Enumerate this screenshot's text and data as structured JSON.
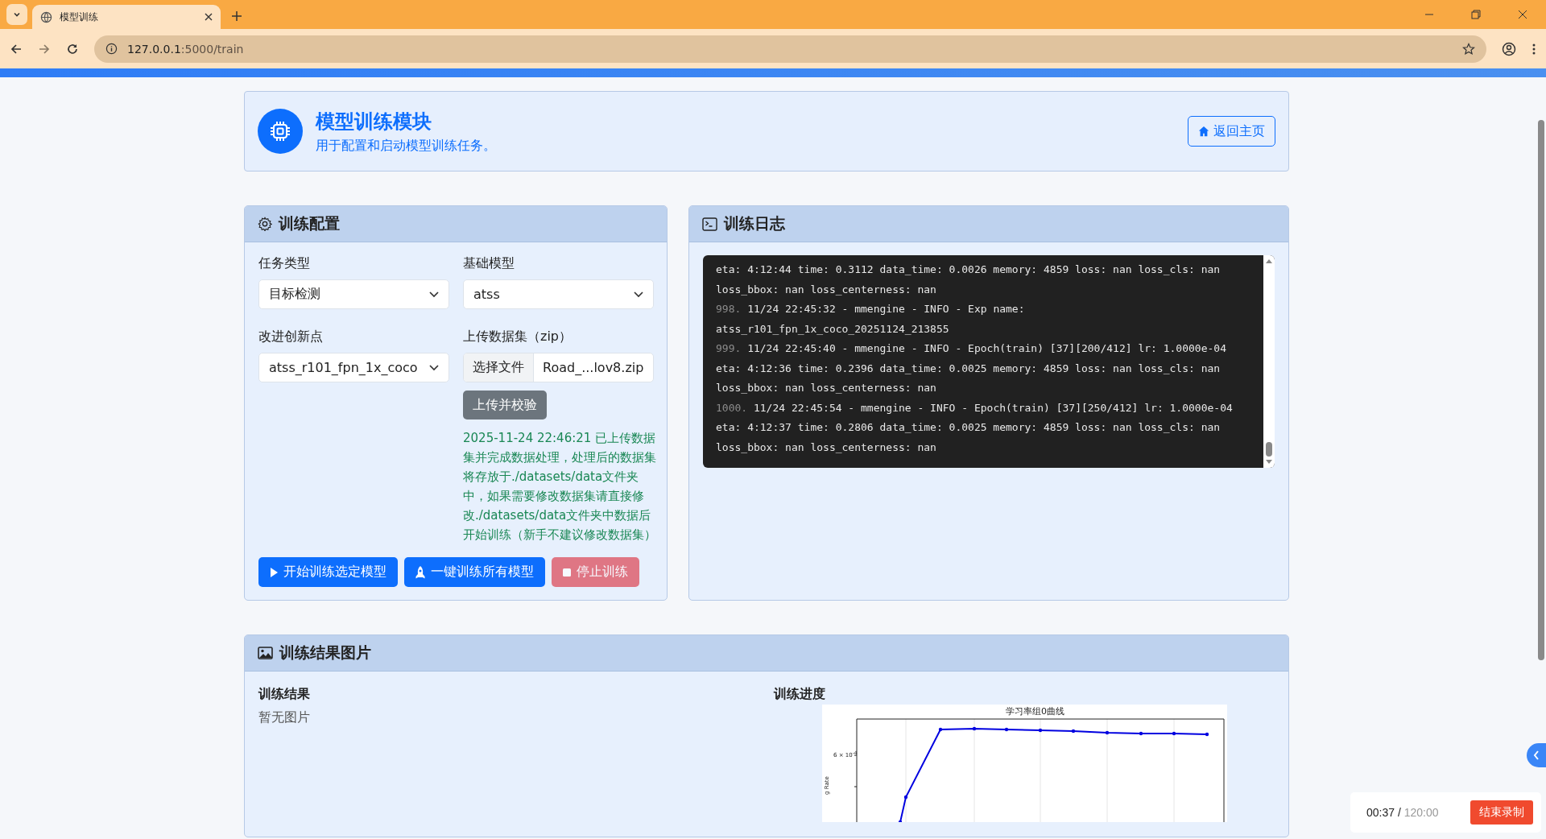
{
  "browser": {
    "tab": {
      "title": "模型训练",
      "selected": true
    },
    "address": {
      "host": "127.0.0.1",
      "path": ":5000/train"
    }
  },
  "header": {
    "title": "模型训练模块",
    "subtitle": "用于配置和启动模型训练任务。",
    "home_button": "返回主页"
  },
  "config": {
    "title": "训练配置",
    "fields": [
      {
        "label": "任务类型",
        "kind": "select",
        "value": "目标检测"
      },
      {
        "label": "基础模型",
        "kind": "select",
        "value": "atss"
      },
      {
        "label": "改进创新点",
        "kind": "select",
        "value": "atss_r101_fpn_1x_coco"
      },
      {
        "label": "上传数据集（zip）",
        "kind": "file",
        "button": "选择文件",
        "value": "Road_...lov8.zip"
      }
    ],
    "upload_button": "上传并校验",
    "upload_message": "2025-11-24 22:46:21 已上传数据集并完成数据处理，处理后的数据集将存放于./datasets/data文件夹中，如果需要修改数据集请直接修改./datasets/data文件夹中数据后开始训练（新手不建议修改数据集）",
    "actions": [
      {
        "label": "开始训练选定模型",
        "kind": "start",
        "disabled": false
      },
      {
        "label": "一键训练所有模型",
        "kind": "all",
        "disabled": false
      },
      {
        "label": "停止训练",
        "kind": "stop",
        "disabled": true
      }
    ]
  },
  "log": {
    "title": "训练日志",
    "entries": [
      {
        "lines": [
          "eta: 4:12:44 time: 0.3112 data_time: 0.0026 memory: 4859 loss: nan loss_cls: nan",
          "loss_bbox: nan loss_centerness: nan"
        ]
      },
      {
        "number": "998.",
        "lines": [
          "11/24 22:45:32 - mmengine - INFO - Exp name:",
          "atss_r101_fpn_1x_coco_20251124_213855"
        ]
      },
      {
        "number": "999.",
        "lines": [
          "11/24 22:45:40 - mmengine - INFO - Epoch(train) [37][200/412] lr: 1.0000e-04",
          "eta: 4:12:36 time: 0.2396 data_time: 0.0025 memory: 4859 loss: nan loss_cls: nan",
          "loss_bbox: nan loss_centerness: nan"
        ]
      },
      {
        "number": "1000.",
        "lines": [
          "11/24 22:45:54 - mmengine - INFO - Epoch(train) [37][250/412] lr: 1.0000e-04",
          "eta: 4:12:37 time: 0.2806 data_time: 0.0025 memory: 4859 loss: nan loss_cls: nan",
          "loss_bbox: nan loss_centerness: nan"
        ]
      }
    ]
  },
  "results": {
    "title": "训练结果图片",
    "result": {
      "title": "训练结果",
      "empty": "暂无图片"
    },
    "progress": {
      "title": "训练进度",
      "image": {
        "title": "学习率组0曲线",
        "ytick": "6 × 10$^{-4}$",
        "ylabel": "g Rate"
      }
    }
  },
  "recorder": {
    "elapsed": "00:37",
    "separator": "/",
    "limit": "120:00",
    "stop_button": "结束录制"
  }
}
